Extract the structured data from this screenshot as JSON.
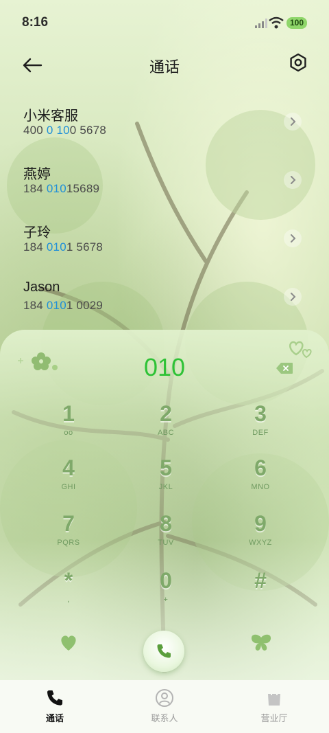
{
  "status": {
    "time": "8:16",
    "battery": "100"
  },
  "header": {
    "title": "通话"
  },
  "contacts": [
    {
      "name": "小米客服",
      "num_parts": [
        [
          "400 ",
          false
        ],
        [
          "0",
          true
        ],
        [
          " ",
          false
        ],
        [
          "10",
          true
        ],
        [
          "0 5678",
          false
        ]
      ]
    },
    {
      "name": "燕婷",
      "num_parts": [
        [
          "184 ",
          false
        ],
        [
          "010",
          true
        ],
        [
          "15689",
          false
        ]
      ]
    },
    {
      "name": "子玲",
      "num_parts": [
        [
          "184 ",
          false
        ],
        [
          "010",
          true
        ],
        [
          "1 5678",
          false
        ]
      ]
    },
    {
      "name": "Jason",
      "num_parts": [
        [
          "184 ",
          false
        ],
        [
          "010",
          true
        ],
        [
          "1 0029",
          false
        ]
      ]
    }
  ],
  "dialer": {
    "input": "010"
  },
  "keys": [
    {
      "digit": "1",
      "letters": "ᴏᴏ",
      "voicemail": true
    },
    {
      "digit": "2",
      "letters": "ABC"
    },
    {
      "digit": "3",
      "letters": "DEF"
    },
    {
      "digit": "4",
      "letters": "GHI"
    },
    {
      "digit": "5",
      "letters": "JKL"
    },
    {
      "digit": "6",
      "letters": "MNO"
    },
    {
      "digit": "7",
      "letters": "PQRS"
    },
    {
      "digit": "8",
      "letters": "TUV"
    },
    {
      "digit": "9",
      "letters": "WXYZ"
    },
    {
      "digit": "*",
      "letters": ","
    },
    {
      "digit": "0",
      "letters": "+"
    },
    {
      "digit": "#",
      "letters": ""
    }
  ],
  "tabs": [
    {
      "label": "通话",
      "active": true
    },
    {
      "label": "联系人",
      "active": false
    },
    {
      "label": "营业厅",
      "active": false
    }
  ],
  "colors": {
    "accent": "#2ec236",
    "highlight": "#1f8fd8",
    "key": "#7fa96a"
  }
}
